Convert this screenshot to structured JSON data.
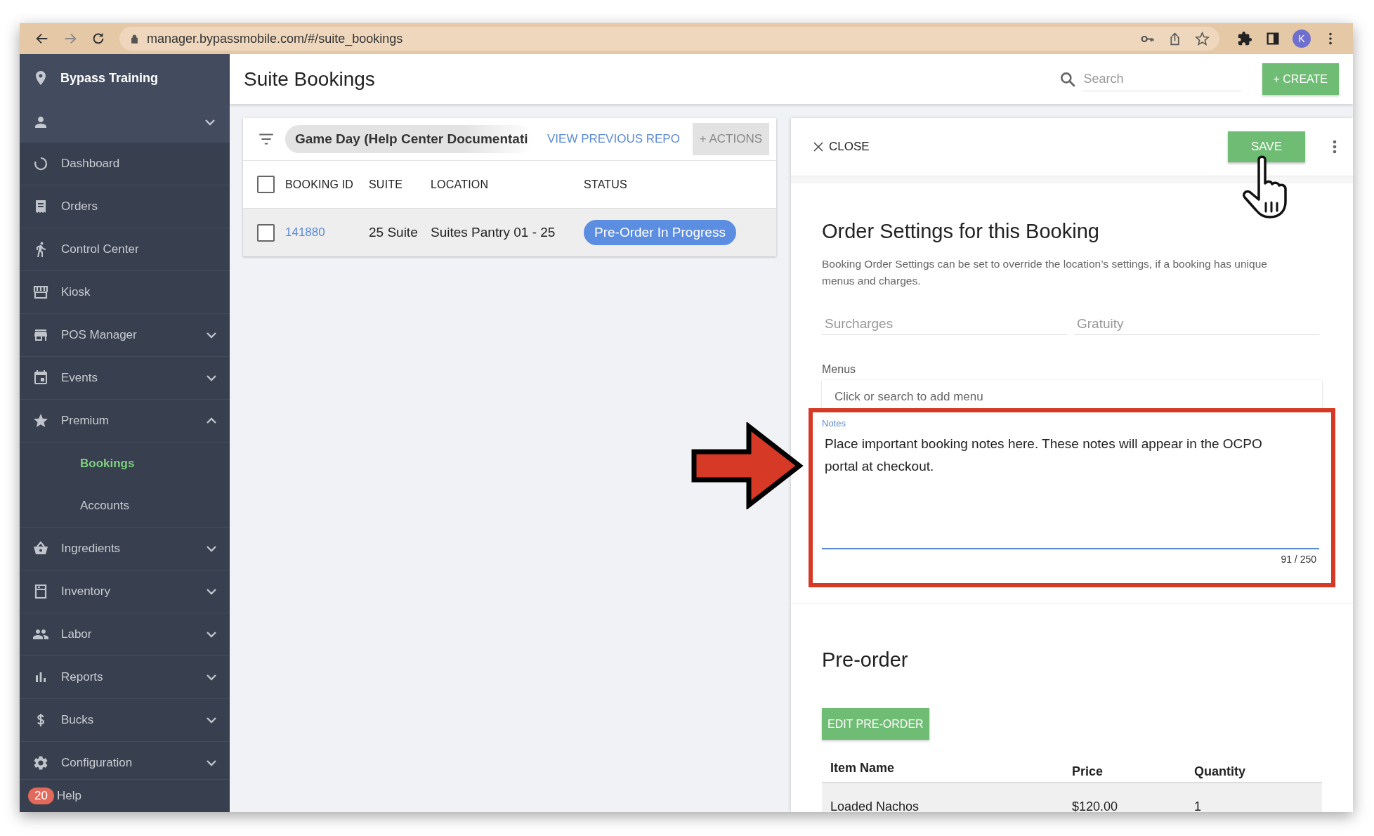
{
  "browser": {
    "url": "manager.bypassmobile.com/#/suite_bookings",
    "profile": "K"
  },
  "sidebar": {
    "org": "Bypass Training",
    "items": [
      {
        "label": "Dashboard",
        "selected": false
      },
      {
        "label": "Orders",
        "selected": false
      },
      {
        "label": "Control Center",
        "selected": false
      },
      {
        "label": "Kiosk",
        "selected": false
      },
      {
        "label": "POS Manager",
        "expanded": false,
        "selected": false
      },
      {
        "label": "Events",
        "expanded": false,
        "selected": false
      },
      {
        "label": "Premium",
        "expanded": true,
        "selected": false,
        "children": [
          {
            "label": "Bookings",
            "selected": true
          },
          {
            "label": "Accounts",
            "selected": false
          }
        ]
      },
      {
        "label": "Ingredients",
        "expanded": false,
        "selected": false
      },
      {
        "label": "Inventory",
        "expanded": false,
        "selected": false
      },
      {
        "label": "Labor",
        "expanded": false,
        "selected": false
      },
      {
        "label": "Reports",
        "expanded": false,
        "selected": false
      },
      {
        "label": "Bucks",
        "expanded": false,
        "selected": false
      },
      {
        "label": "Configuration",
        "expanded": false,
        "selected": false
      }
    ],
    "help": {
      "badge": "20",
      "label": "Help"
    }
  },
  "header": {
    "title": "Suite Bookings",
    "search_placeholder": "Search",
    "create_button": "+ CREATE"
  },
  "bookings": {
    "filter_chip": "Game Day (Help Center Documentati",
    "report_link": "VIEW PREVIOUS REPO",
    "actions_button": "+ ACTIONS",
    "select_all_checked": false,
    "columns": [
      "BOOKING ID",
      "SUITE",
      "LOCATION",
      "STATUS"
    ],
    "rows": [
      {
        "booking_id": "141880",
        "suite": "25 Suite",
        "location": "Suites Pantry 01 - 25",
        "status": "Pre-Order In Progress",
        "checked": false
      }
    ]
  },
  "detail": {
    "close": "CLOSE",
    "save": "SAVE",
    "order_settings": {
      "title": "Order Settings for this Booking",
      "description": "Booking Order Settings can be set to override the location’s settings, if a booking has unique menus and charges.",
      "surcharges_placeholder": "Surcharges",
      "gratuity_placeholder": "Gratuity",
      "menus_label": "Menus",
      "menus_placeholder": "Click or search to add menu",
      "notes_label": "Notes",
      "notes_value": "Place important booking notes here. These notes will appear in the OCPO portal at checkout.",
      "notes_counter": "91 / 250"
    },
    "preorder": {
      "title": "Pre-order",
      "edit_button": "EDIT PRE-ORDER",
      "columns": [
        "Item Name",
        "Price",
        "Quantity"
      ],
      "rows": [
        {
          "item_name": "Loaded Nachos",
          "price": "$120.00",
          "quantity": "1"
        }
      ]
    }
  }
}
